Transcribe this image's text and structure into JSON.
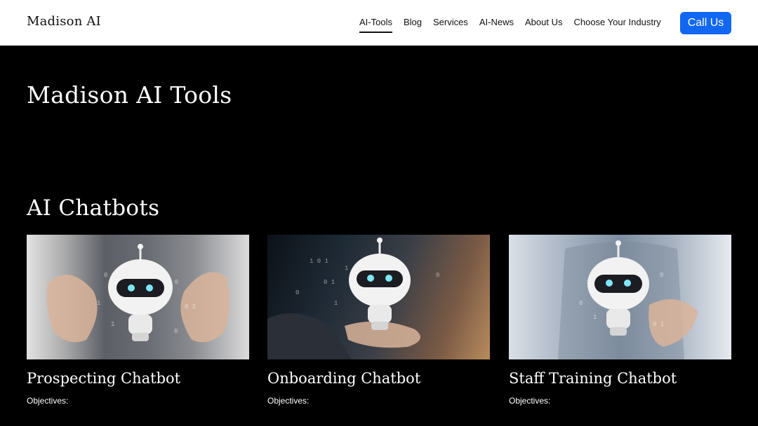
{
  "header": {
    "brand": "Madison AI",
    "nav": [
      {
        "label": "AI-Tools",
        "active": true
      },
      {
        "label": "Blog",
        "active": false
      },
      {
        "label": "Services",
        "active": false
      },
      {
        "label": "AI-News",
        "active": false
      },
      {
        "label": "About Us",
        "active": false
      },
      {
        "label": "Choose Your Industry",
        "active": false
      }
    ],
    "cta_label": "Call Us"
  },
  "hero": {
    "title": "Madison AI Tools"
  },
  "section": {
    "title": "AI Chatbots",
    "cards": [
      {
        "title": "Prospecting Chatbot",
        "subtitle": "Objectives:",
        "image": "robot-hands-image"
      },
      {
        "title": "Onboarding Chatbot",
        "subtitle": "Objectives:",
        "image": "robot-palm-image"
      },
      {
        "title": "Staff Training Chatbot",
        "subtitle": "Objectives:",
        "image": "robot-hand-image"
      }
    ]
  },
  "colors": {
    "cta": "#1167f2",
    "header_bg": "#ffffff",
    "page_bg": "#000000"
  }
}
